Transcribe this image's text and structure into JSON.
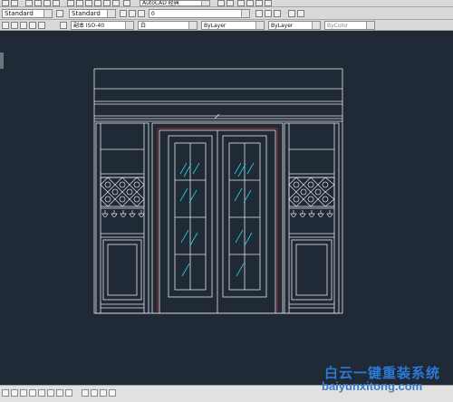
{
  "toolbar_row1": {
    "workspace": "AutoCAD 经典"
  },
  "toolbar_row2": {
    "text_style": "Standard",
    "dim_style": "Standard",
    "layer": "0"
  },
  "toolbar_row3": {
    "dim_scale": "副本 ISO-40",
    "color": "白",
    "linetype": "ByLayer",
    "lineweight": "ByLayer",
    "plotstyle": "ByColor"
  },
  "watermark": {
    "line1": "白云一键重装系统",
    "line2": "baiyunxitong.com"
  },
  "colors": {
    "canvas": "#1f2a36",
    "line": "#e6e6e6",
    "accent_red": "#b3282d",
    "glass": "#21d6e6"
  }
}
